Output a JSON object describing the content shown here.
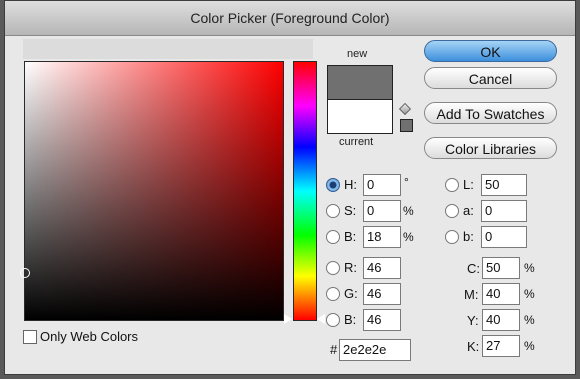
{
  "window": {
    "title": "Color Picker (Foreground Color)"
  },
  "swatch": {
    "new_label": "new",
    "current_label": "current",
    "new_color": "#707070",
    "current_color": "#ffffff"
  },
  "buttons": {
    "ok": "OK",
    "cancel": "Cancel",
    "add": "Add To Swatches",
    "libraries": "Color Libraries"
  },
  "web_colors": {
    "label": "Only Web Colors",
    "checked": false
  },
  "hsb": {
    "h": {
      "label": "H:",
      "value": "0",
      "unit": "°",
      "selected": true
    },
    "s": {
      "label": "S:",
      "value": "0",
      "unit": "%"
    },
    "b": {
      "label": "B:",
      "value": "18",
      "unit": "%"
    }
  },
  "rgb": {
    "r": {
      "label": "R:",
      "value": "46"
    },
    "g": {
      "label": "G:",
      "value": "46"
    },
    "b": {
      "label": "B:",
      "value": "46"
    }
  },
  "lab": {
    "l": {
      "label": "L:",
      "value": "50"
    },
    "a": {
      "label": "a:",
      "value": "0"
    },
    "b": {
      "label": "b:",
      "value": "0"
    }
  },
  "cmyk": {
    "c": {
      "label": "C:",
      "value": "50",
      "unit": "%"
    },
    "m": {
      "label": "M:",
      "value": "40",
      "unit": "%"
    },
    "y": {
      "label": "Y:",
      "value": "40",
      "unit": "%"
    },
    "k": {
      "label": "K:",
      "value": "27",
      "unit": "%"
    }
  },
  "hex": {
    "label": "#",
    "value": "2e2e2e"
  },
  "colors": {
    "accent": "#3d8fdc"
  }
}
